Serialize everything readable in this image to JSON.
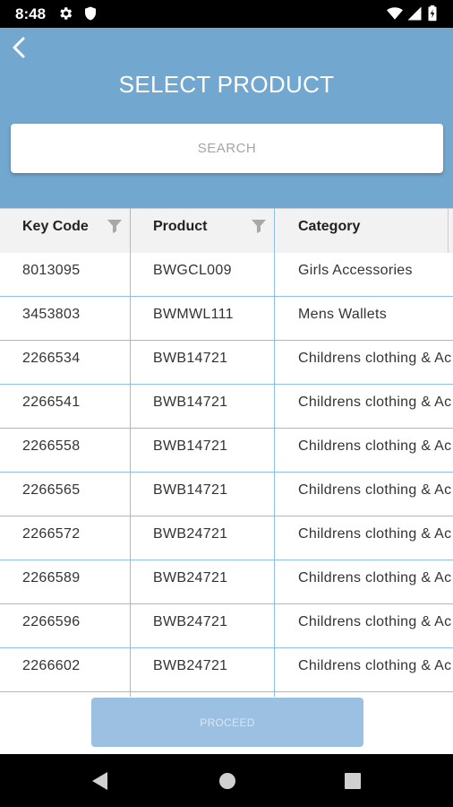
{
  "status_bar": {
    "time": "8:48",
    "icons": [
      "gear-icon",
      "shield-icon",
      "wifi-icon",
      "signal-icon",
      "battery-icon"
    ]
  },
  "header": {
    "title": "SELECT PRODUCT",
    "search_placeholder": "SEARCH",
    "background_color": "#72a8d0"
  },
  "table": {
    "columns": [
      {
        "label": "Key Code",
        "filter": true
      },
      {
        "label": "Product",
        "filter": true
      },
      {
        "label": "Category",
        "filter": false
      }
    ],
    "rows": [
      {
        "key_code": "8013095",
        "product": "BWGCL009",
        "category": "Girls Accessories"
      },
      {
        "key_code": "3453803",
        "product": "BWMWL111",
        "category": "Mens Wallets"
      },
      {
        "key_code": "2266534",
        "product": "BWB14721",
        "category": "Childrens clothing & Ac"
      },
      {
        "key_code": "2266541",
        "product": "BWB14721",
        "category": "Childrens clothing & Ac"
      },
      {
        "key_code": "2266558",
        "product": "BWB14721",
        "category": "Childrens clothing & Ac"
      },
      {
        "key_code": "2266565",
        "product": "BWB14721",
        "category": "Childrens clothing & Ac"
      },
      {
        "key_code": "2266572",
        "product": "BWB24721",
        "category": "Childrens clothing & Ac"
      },
      {
        "key_code": "2266589",
        "product": "BWB24721",
        "category": "Childrens clothing & Ac"
      },
      {
        "key_code": "2266596",
        "product": "BWB24721",
        "category": "Childrens clothing & Ac"
      },
      {
        "key_code": "2266602",
        "product": "BWB24721",
        "category": "Childrens clothing & Ac"
      }
    ],
    "grid_color": "#8ec1ea"
  },
  "footer": {
    "proceed_label": "PROCEED",
    "proceed_color": "#9cc0e1"
  },
  "nav_bar": {
    "icons": [
      "back-triangle-icon",
      "home-circle-icon",
      "recents-square-icon"
    ]
  }
}
